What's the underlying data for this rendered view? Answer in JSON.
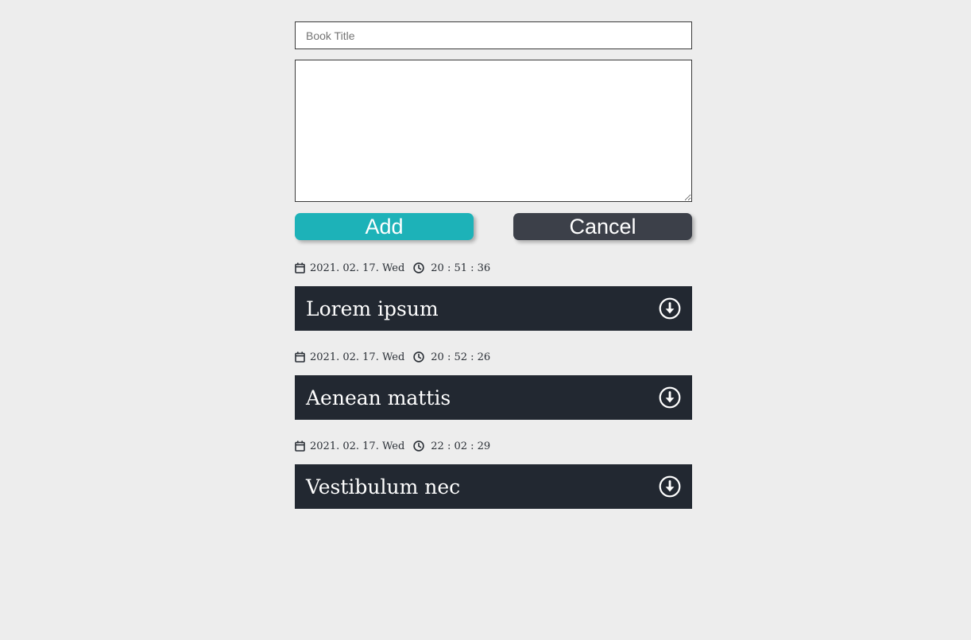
{
  "form": {
    "title_placeholder": "Book Title",
    "title_value": "",
    "body_value": "",
    "add_label": "Add",
    "cancel_label": "Cancel"
  },
  "entries": [
    {
      "date": "2021. 02. 17. Wed",
      "time": "20 : 51 : 36",
      "title": "Lorem ipsum"
    },
    {
      "date": "2021. 02. 17. Wed",
      "time": "20 : 52 : 26",
      "title": "Aenean mattis"
    },
    {
      "date": "2021. 02. 17. Wed",
      "time": "22 : 02 : 29",
      "title": "Vestibulum nec"
    }
  ],
  "icons": {
    "date": "calendar-icon",
    "time": "clock-icon",
    "expand": "arrow-circle-down-icon"
  },
  "colors": {
    "background": "#ededed",
    "add_button": "#1db2b8",
    "cancel_button": "#3c4049",
    "card": "#222831"
  }
}
